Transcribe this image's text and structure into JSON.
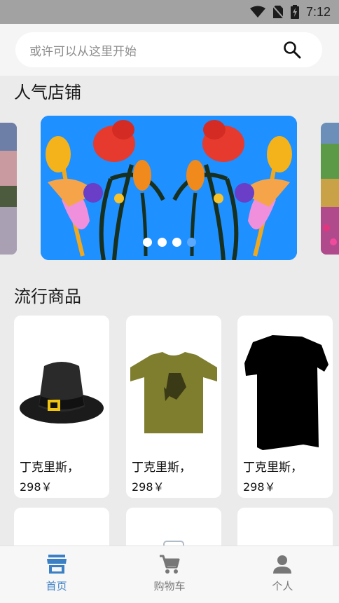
{
  "status_bar": {
    "time": "7:12"
  },
  "search": {
    "placeholder": "或许可以从这里开始",
    "icon": "search-icon"
  },
  "sections": {
    "shops_title": "人气店铺",
    "products_title": "流行商品"
  },
  "carousel": {
    "dot_count": 4,
    "active_dots": 3
  },
  "products": [
    {
      "name": "丁克里斯，",
      "price": "298￥",
      "image": "pilgrim-hat"
    },
    {
      "name": "丁克里斯，",
      "price": "298￥",
      "image": "olive-tshirt"
    },
    {
      "name": "丁克里斯，",
      "price": "298￥",
      "image": "black-shirt"
    }
  ],
  "tabbar": {
    "items": [
      {
        "label": "首页",
        "icon": "store-icon",
        "active": true
      },
      {
        "label": "购物车",
        "icon": "cart-icon",
        "active": false
      },
      {
        "label": "个人",
        "icon": "person-icon",
        "active": false
      }
    ]
  },
  "colors": {
    "accent": "#3b7fc4",
    "banner": "#1e90ff",
    "background": "#ebebeb"
  }
}
